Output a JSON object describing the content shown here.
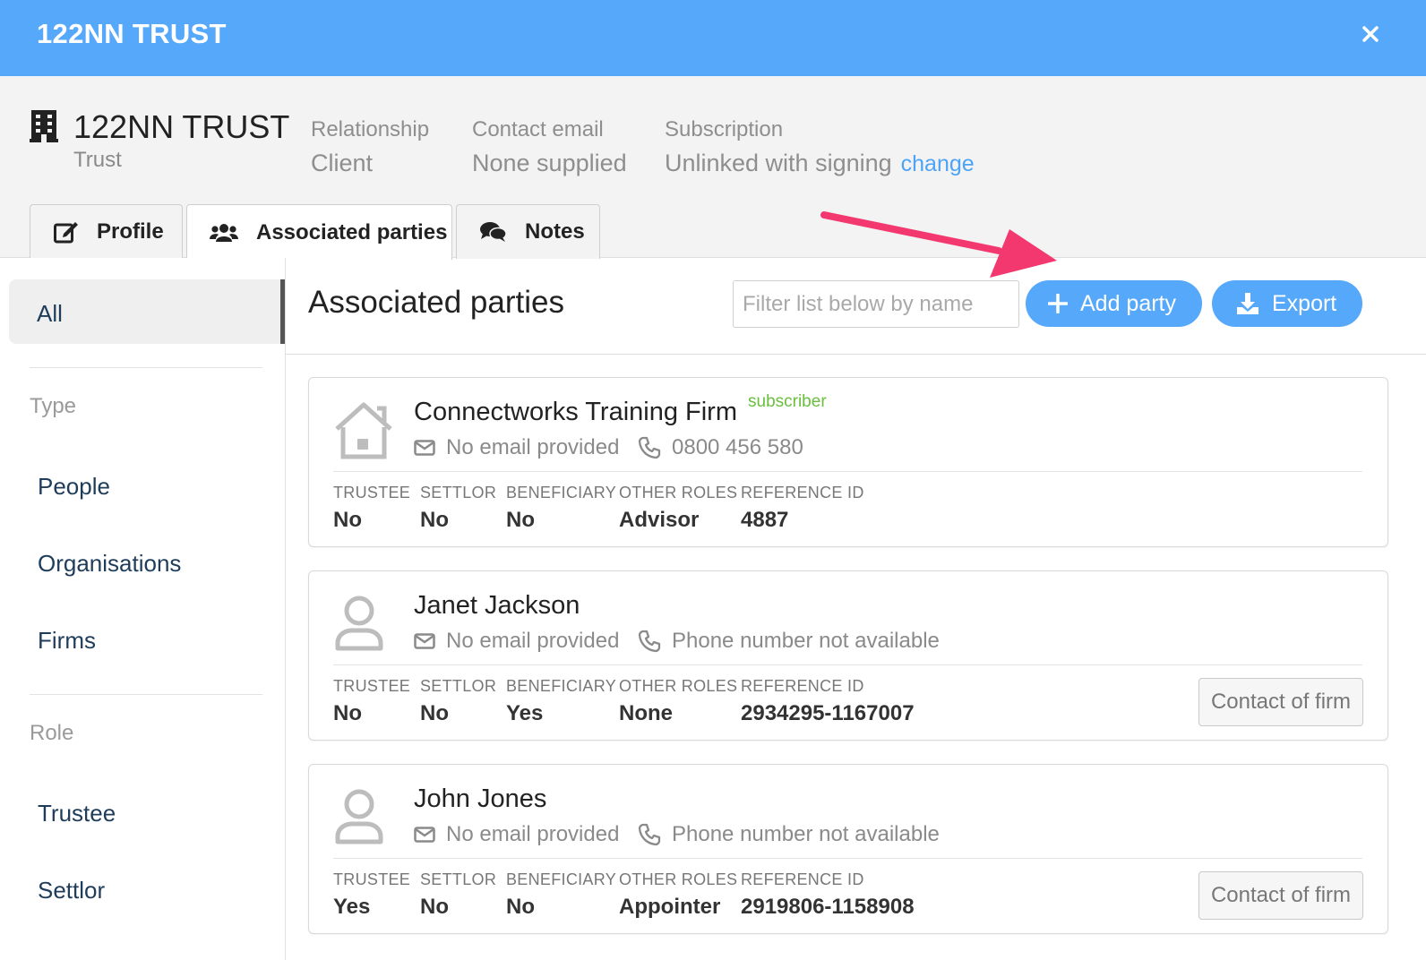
{
  "window": {
    "title": "122NN TRUST",
    "close_icon": "close-icon"
  },
  "entity": {
    "name": "122NN TRUST",
    "type": "Trust",
    "icon": "building-icon",
    "relationship": {
      "label": "Relationship",
      "value": "Client"
    },
    "contact_email": {
      "label": "Contact email",
      "value": "None supplied"
    },
    "subscription": {
      "label": "Subscription",
      "value": "Unlinked with signing",
      "action": "change"
    }
  },
  "tabs": [
    {
      "label": "Profile",
      "icon": "edit-icon",
      "active": false
    },
    {
      "label": "Associated parties",
      "icon": "users-icon",
      "active": true
    },
    {
      "label": "Notes",
      "icon": "comments-icon",
      "active": false
    }
  ],
  "sidebar": {
    "all_label": "All",
    "type_heading": "Type",
    "type_items": [
      "People",
      "Organisations",
      "Firms"
    ],
    "role_heading": "Role",
    "role_items": [
      "Trustee",
      "Settlor"
    ]
  },
  "main": {
    "title": "Associated parties",
    "filter_placeholder": "Filter list below by name",
    "add_party_label": "Add party",
    "export_label": "Export"
  },
  "columns": {
    "trustee": "TRUSTEE",
    "settlor": "SETTLOR",
    "beneficiary": "BENEFICIARY",
    "other_roles": "OTHER ROLES",
    "reference_id": "REFERENCE ID"
  },
  "parties": [
    {
      "name": "Connectworks Training Firm",
      "badge": "subscriber",
      "avatar": "house-icon",
      "email": "No email provided",
      "phone": "0800 456 580",
      "trustee": "No",
      "settlor": "No",
      "beneficiary": "No",
      "other_roles": "Advisor",
      "reference_id": "4887",
      "action": ""
    },
    {
      "name": "Janet Jackson",
      "badge": "",
      "avatar": "user-icon",
      "email": "No email provided",
      "phone": "Phone number not available",
      "trustee": "No",
      "settlor": "No",
      "beneficiary": "Yes",
      "other_roles": "None",
      "reference_id": "2934295-1167007",
      "action": "Contact of firm"
    },
    {
      "name": "John Jones",
      "badge": "",
      "avatar": "user-icon",
      "email": "No email provided",
      "phone": "Phone number not available",
      "trustee": "Yes",
      "settlor": "No",
      "beneficiary": "No",
      "other_roles": "Appointer",
      "reference_id": "2919806-1158908",
      "action": "Contact of firm"
    }
  ],
  "colors": {
    "accent": "#56a8fa",
    "badge": "#6abf3d",
    "annotation_arrow": "#f2386f",
    "nav_text": "#1f3d5a"
  }
}
